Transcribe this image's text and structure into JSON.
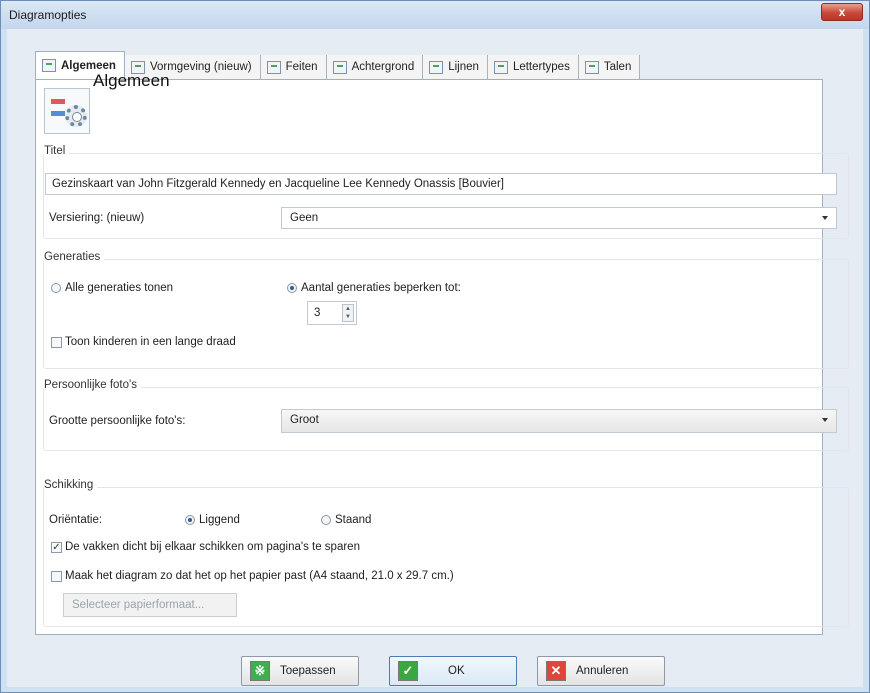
{
  "window": {
    "title": "Diagramopties",
    "close": "x"
  },
  "tabs": [
    {
      "label": "Algemeen",
      "active": true
    },
    {
      "label": "Vormgeving (nieuw)"
    },
    {
      "label": "Feiten"
    },
    {
      "label": "Achtergrond"
    },
    {
      "label": "Lijnen"
    },
    {
      "label": "Lettertypes"
    },
    {
      "label": "Talen"
    }
  ],
  "header": {
    "title": "Algemeen"
  },
  "titel": {
    "label": "Titel",
    "value": "Gezinskaart van John Fitzgerald Kennedy en Jacqueline Lee Kennedy Onassis [Bouvier]",
    "versiering_label": "Versiering: (nieuw)",
    "versiering_value": "Geen"
  },
  "generaties": {
    "label": "Generaties",
    "all_label": "Alle generaties tonen",
    "limit_label": "Aantal generaties beperken tot:",
    "limit_value": "3",
    "kinderen_label": "Toon kinderen in een lange draad"
  },
  "fotos": {
    "label": "Persoonlijke foto's",
    "size_label": "Grootte persoonlijke foto's:",
    "size_value": "Groot"
  },
  "schikking": {
    "label": "Schikking",
    "orientatie_label": "Oriëntatie:",
    "liggend": "Liggend",
    "staand": "Staand",
    "compact_label": "De vakken dicht bij elkaar schikken om pagina's te sparen",
    "fit_label": "Maak het diagram zo dat het op het papier past (A4 staand, 21.0 x 29.7 cm.)",
    "paper_button": "Selecteer papierformaat..."
  },
  "buttons": {
    "apply": "Toepassen",
    "ok": "OK",
    "cancel": "Annuleren"
  },
  "colors": {
    "apply_icon": "#3fae4f",
    "ok_icon": "#39a83e",
    "cancel_icon": "#e0453a"
  }
}
